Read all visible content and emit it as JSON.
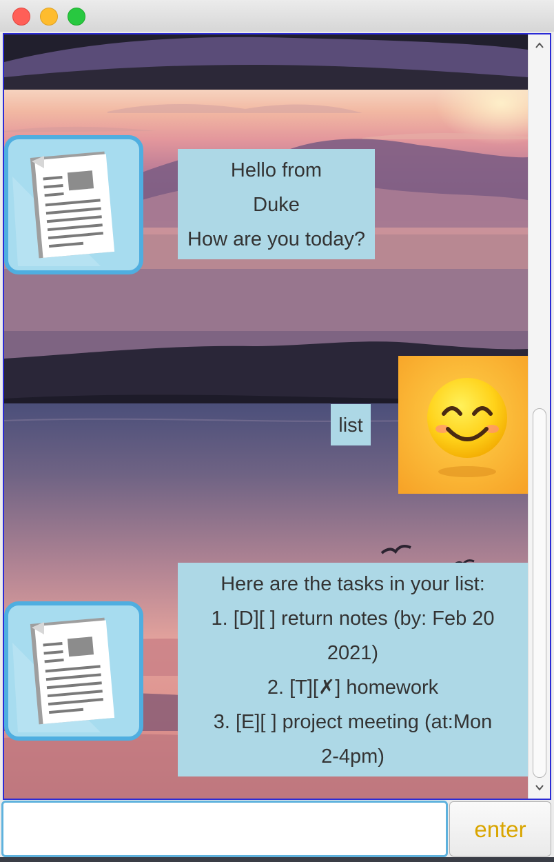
{
  "window": {
    "controls": [
      "close",
      "minimize",
      "maximize"
    ]
  },
  "dialog": {
    "messages": [
      {
        "sender": "duke",
        "avatar_icon": "document-icon",
        "lines": [
          "Hello from",
          "Duke",
          "How are you today?"
        ]
      },
      {
        "sender": "user",
        "avatar_icon": "smiling-emoji-icon",
        "lines": [
          "list"
        ]
      },
      {
        "sender": "duke",
        "avatar_icon": "document-icon",
        "lines": [
          "Here are the tasks in your list:",
          "1. [D][ ] return notes (by: Feb 20",
          "2021)",
          "2. [T][✗] homework",
          "3. [E][ ] project meeting (at:Mon",
          "2-4pm)"
        ]
      }
    ]
  },
  "input": {
    "value": "",
    "placeholder": ""
  },
  "enter_button": {
    "label": "enter"
  },
  "colors": {
    "bubble": "#add8e6",
    "input_border": "#5fb2dd",
    "button_text": "#d9a500",
    "frame_border": "#2b2bd6"
  }
}
